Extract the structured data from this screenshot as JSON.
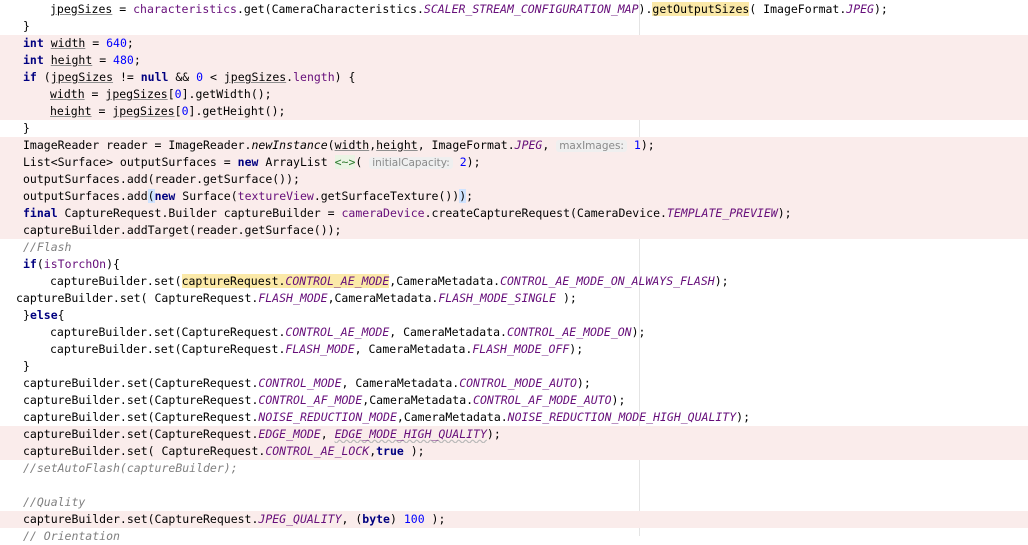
{
  "editor": {
    "lines": [
      {
        "tokens": [
          {
            "t": "jpegSizes",
            "c": "ul"
          },
          {
            "t": " = "
          },
          {
            "t": "characteristics",
            "c": "ifld"
          },
          {
            "t": ".get(CameraCharacteristics."
          },
          {
            "t": "SCALER_STREAM_CONFIGURATION_MAP",
            "c": "fld"
          },
          {
            "t": ")."
          },
          {
            "t": "getOutputSizes",
            "c": "mark"
          },
          {
            "t": "( ImageFormat."
          },
          {
            "t": "JPEG",
            "c": "fld"
          },
          {
            "t": ");"
          }
        ]
      },
      {
        "tokens": [
          {
            "t": "}"
          }
        ]
      },
      {
        "tokens": [
          {
            "t": "int",
            "c": "kw"
          },
          {
            "t": " "
          },
          {
            "t": "width",
            "c": "ul"
          },
          {
            "t": " = "
          },
          {
            "t": "640",
            "c": "num"
          },
          {
            "t": ";"
          }
        ]
      },
      {
        "tokens": [
          {
            "t": "int",
            "c": "kw"
          },
          {
            "t": " "
          },
          {
            "t": "height",
            "c": "ul"
          },
          {
            "t": " = "
          },
          {
            "t": "480",
            "c": "num"
          },
          {
            "t": ";"
          }
        ]
      },
      {
        "tokens": [
          {
            "t": "if",
            "c": "kw"
          },
          {
            "t": " ("
          },
          {
            "t": "jpegSizes",
            "c": "ul"
          },
          {
            "t": " != "
          },
          {
            "t": "null",
            "c": "kw"
          },
          {
            "t": " && "
          },
          {
            "t": "0",
            "c": "num"
          },
          {
            "t": " < "
          },
          {
            "t": "jpegSizes",
            "c": "ul"
          },
          {
            "t": "."
          },
          {
            "t": "length",
            "c": "ifld"
          },
          {
            "t": ") {"
          }
        ]
      },
      {
        "tokens": [
          {
            "t": "width",
            "c": "ul"
          },
          {
            "t": " = "
          },
          {
            "t": "jpegSizes",
            "c": "ul"
          },
          {
            "t": "["
          },
          {
            "t": "0",
            "c": "num"
          },
          {
            "t": "].getWidth();"
          }
        ]
      },
      {
        "tokens": [
          {
            "t": "height",
            "c": "ul"
          },
          {
            "t": " = "
          },
          {
            "t": "jpegSizes",
            "c": "ul"
          },
          {
            "t": "["
          },
          {
            "t": "0",
            "c": "num"
          },
          {
            "t": "].getHeight();"
          }
        ]
      },
      {
        "tokens": [
          {
            "t": "}"
          }
        ]
      },
      {
        "tokens": [
          {
            "t": "ImageReader reader = ImageReader."
          },
          {
            "t": "newInstance",
            "c": "sm"
          },
          {
            "t": "("
          },
          {
            "t": "width",
            "c": "ul"
          },
          {
            "t": ","
          },
          {
            "t": "height",
            "c": "ul"
          },
          {
            "t": ", ImageFormat."
          },
          {
            "t": "JPEG",
            "c": "fld"
          },
          {
            "t": ", "
          },
          {
            "t": "maxImages:",
            "c": "hint"
          },
          {
            "t": " "
          },
          {
            "t": "1",
            "c": "num"
          },
          {
            "t": ");"
          }
        ]
      },
      {
        "tokens": [
          {
            "t": "List<Surface> outputSurfaces = "
          },
          {
            "t": "new",
            "c": "kw"
          },
          {
            "t": " ArrayList "
          },
          {
            "t": "<~>",
            "c": "diamond"
          },
          {
            "t": "( "
          },
          {
            "t": "initialCapacity:",
            "c": "hint"
          },
          {
            "t": " "
          },
          {
            "t": "2",
            "c": "num"
          },
          {
            "t": ");"
          }
        ]
      },
      {
        "tokens": [
          {
            "t": "outputSurfaces.add(reader.getSurface());"
          }
        ]
      },
      {
        "tokens": [
          {
            "t": "outputSurfaces.add"
          },
          {
            "t": "(",
            "c": "brace-match"
          },
          {
            "t": "new",
            "c": "kw"
          },
          {
            "t": " Surface("
          },
          {
            "t": "textureView",
            "c": "ifld"
          },
          {
            "t": ".getSurfaceTexture())"
          },
          {
            "t": ")",
            "c": "brace-match"
          },
          {
            "t": ";"
          }
        ]
      },
      {
        "tokens": [
          {
            "t": "final",
            "c": "kw"
          },
          {
            "t": " CaptureRequest.Builder captureBuilder = "
          },
          {
            "t": "cameraDevice",
            "c": "ifld"
          },
          {
            "t": ".createCaptureRequest(CameraDevice."
          },
          {
            "t": "TEMPLATE_PREVIEW",
            "c": "fld"
          },
          {
            "t": ");"
          }
        ]
      },
      {
        "tokens": [
          {
            "t": "captureBuilder.addTarget(reader.getSurface());"
          }
        ]
      },
      {
        "tokens": [
          {
            "t": "//Flash",
            "c": "cmt"
          }
        ]
      },
      {
        "tokens": [
          {
            "t": "if",
            "c": "kw"
          },
          {
            "t": "("
          },
          {
            "t": "isTorchOn",
            "c": "ifld"
          },
          {
            "t": "){"
          }
        ]
      },
      {
        "tokens": [
          {
            "t": "captureBuilder.set("
          },
          {
            "t": "captureRequest.",
            "c": "mark"
          },
          {
            "t": "CONTROL_AE_MODE",
            "c": "fld mark"
          },
          {
            "t": ",CameraMetadata."
          },
          {
            "t": "CONTROL_AE_MODE_ON_ALWAYS_FLASH",
            "c": "fld"
          },
          {
            "t": ");"
          }
        ]
      },
      {
        "tokens": [
          {
            "t": "captureBuilder.set( CaptureRequest."
          },
          {
            "t": "FLASH_MODE",
            "c": "fld"
          },
          {
            "t": ",CameraMetadata."
          },
          {
            "t": "FLASH_MODE_SINGLE",
            "c": "fld"
          },
          {
            "t": " );"
          }
        ]
      },
      {
        "tokens": [
          {
            "t": "}"
          },
          {
            "t": "else",
            "c": "kw"
          },
          {
            "t": "{"
          }
        ]
      },
      {
        "tokens": [
          {
            "t": "captureBuilder.set(CaptureRequest."
          },
          {
            "t": "CONTROL_AE_MODE",
            "c": "fld"
          },
          {
            "t": ", CameraMetadata."
          },
          {
            "t": "CONTROL_AE_MODE_ON",
            "c": "fld"
          },
          {
            "t": ");"
          }
        ]
      },
      {
        "tokens": [
          {
            "t": "captureBuilder.set(CaptureRequest."
          },
          {
            "t": "FLASH_MODE",
            "c": "fld"
          },
          {
            "t": ", CameraMetadata."
          },
          {
            "t": "FLASH_MODE_OFF",
            "c": "fld"
          },
          {
            "t": ");"
          }
        ]
      },
      {
        "tokens": [
          {
            "t": "}"
          }
        ]
      },
      {
        "tokens": [
          {
            "t": "captureBuilder.set(CaptureRequest."
          },
          {
            "t": "CONTROL_MODE",
            "c": "fld"
          },
          {
            "t": ", CameraMetadata."
          },
          {
            "t": "CONTROL_MODE_AUTO",
            "c": "fld"
          },
          {
            "t": ");"
          }
        ]
      },
      {
        "tokens": [
          {
            "t": "captureBuilder.set(CaptureRequest."
          },
          {
            "t": "CONTROL_AF_MODE",
            "c": "fld"
          },
          {
            "t": ",CameraMetadata."
          },
          {
            "t": "CONTROL_AF_MODE_AUTO",
            "c": "fld"
          },
          {
            "t": ");"
          }
        ]
      },
      {
        "tokens": [
          {
            "t": "captureBuilder.set(CaptureRequest."
          },
          {
            "t": "NOISE_REDUCTION_MODE",
            "c": "fld"
          },
          {
            "t": ",CameraMetadata."
          },
          {
            "t": "NOISE_REDUCTION_MODE_HIGH_QUALITY",
            "c": "fld"
          },
          {
            "t": ");"
          }
        ]
      },
      {
        "tokens": [
          {
            "t": "captureBuilder.set(CaptureRequest."
          },
          {
            "t": "EDGE_MODE",
            "c": "fld"
          },
          {
            "t": ", "
          },
          {
            "t": "EDGE_MODE_HIGH_QUALITY",
            "c": "fld err-ul"
          },
          {
            "t": ");"
          }
        ]
      },
      {
        "tokens": [
          {
            "t": "captureBuilder.set( CaptureRequest."
          },
          {
            "t": "CONTROL_AE_LOCK",
            "c": "fld"
          },
          {
            "t": ","
          },
          {
            "t": "true",
            "c": "kw"
          },
          {
            "t": " );"
          }
        ]
      },
      {
        "tokens": [
          {
            "t": "//setAutoFlash(captureBuilder);",
            "c": "cmt"
          }
        ]
      },
      {
        "tokens": []
      },
      {
        "tokens": [
          {
            "t": "//Quality",
            "c": "cmt"
          }
        ]
      },
      {
        "tokens": [
          {
            "t": "captureBuilder.set(CaptureRequest."
          },
          {
            "t": "JPEG_QUALITY",
            "c": "fld"
          },
          {
            "t": ", ("
          },
          {
            "t": "byte",
            "c": "kw"
          },
          {
            "t": ") "
          },
          {
            "t": "100",
            "c": "num"
          },
          {
            "t": " );"
          }
        ]
      },
      {
        "tokens": [
          {
            "t": "// Orientation",
            "c": "cmt"
          }
        ]
      }
    ]
  },
  "colors": {
    "highlight_line": "#faeceb",
    "keyword": "#000080",
    "number": "#0000ff",
    "field": "#660e7a",
    "comment": "#808080",
    "search_match": "#fbe9a8"
  }
}
